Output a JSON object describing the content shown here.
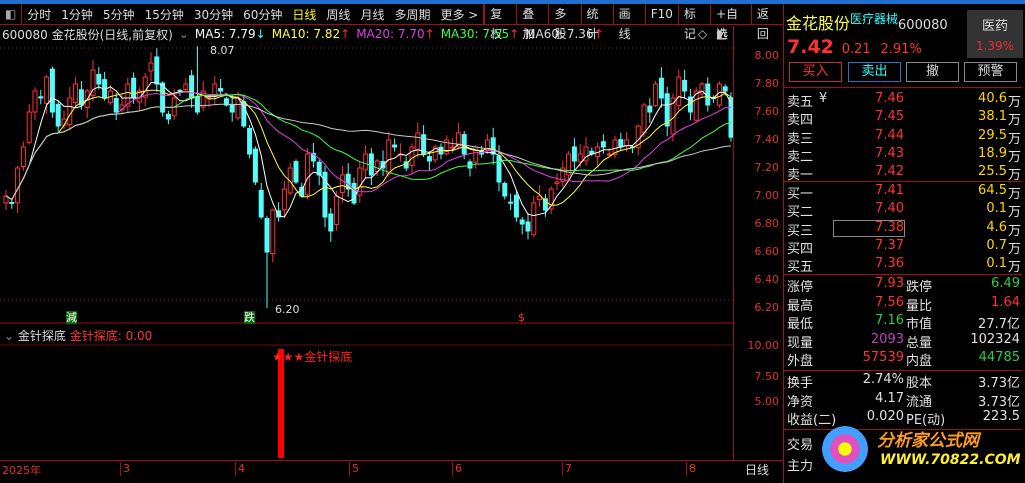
{
  "toolbar": {
    "items": [
      "分时",
      "1分钟",
      "5分钟",
      "15分钟",
      "30分钟",
      "60分钟",
      "日线",
      "周线",
      "月线",
      "多周期",
      "更多 >"
    ],
    "active": "日线",
    "buttons": [
      "复权",
      "叠加",
      "多股",
      "统计",
      "画线",
      "F10",
      "标记",
      "+自选",
      "返回"
    ]
  },
  "info": {
    "title": "600080 金花股份(日线,前复权)",
    "ma5": "MA5: 7.79",
    "ma10": "MA10: 7.82",
    "ma20": "MA20: 7.70",
    "ma30": "MA30: 7.55",
    "ma60": "MA60: 7.36",
    "ma5_dir": "↓",
    "up": "↑"
  },
  "chart_labels": {
    "high": "8.07",
    "low": "6.20",
    "sig1": "減",
    "sig2": "跌",
    "sig3": "$"
  },
  "indicator": {
    "name": "金针探底",
    "value_label": "金针探底: 0.00",
    "signal_text": "★★★金针探底",
    "axis": [
      "10.00",
      "7.50",
      "5.00"
    ]
  },
  "price_axis": [
    "8.00",
    "7.80",
    "7.60",
    "7.40",
    "7.20",
    "7.00",
    "6.80",
    "6.60",
    "6.40",
    "6.20"
  ],
  "time_axis": [
    "2025年",
    "3",
    "4",
    "5",
    "6",
    "7",
    "8"
  ],
  "period_label": "日线",
  "chart_data": {
    "type": "candlestick",
    "ylim": [
      6.1,
      8.2
    ],
    "closes": [
      7.0,
      6.95,
      7.2,
      7.35,
      7.6,
      7.75,
      7.7,
      7.85,
      7.6,
      7.5,
      7.55,
      7.7,
      7.8,
      7.65,
      7.75,
      7.9,
      7.8,
      7.7,
      7.75,
      7.6,
      7.65,
      7.8,
      7.7,
      7.75,
      7.85,
      7.95,
      7.8,
      7.6,
      7.55,
      7.7,
      7.75,
      7.8,
      7.7,
      7.6,
      7.75,
      7.7,
      7.8,
      7.75,
      7.65,
      7.6,
      7.7,
      7.5,
      7.3,
      7.1,
      6.85,
      6.6,
      6.9,
      6.85,
      7.05,
      7.2,
      7.1,
      7.0,
      7.3,
      7.25,
      7.15,
      6.85,
      6.75,
      7.0,
      7.15,
      7.05,
      6.95,
      7.2,
      7.3,
      7.15,
      7.25,
      7.2,
      7.4,
      7.35,
      7.3,
      7.2,
      7.35,
      7.45,
      7.3,
      7.25,
      7.35,
      7.3,
      7.4,
      7.35,
      7.45,
      7.3,
      7.2,
      7.35,
      7.3,
      7.4,
      7.3,
      7.1,
      7.0,
      6.95,
      6.85,
      6.8,
      6.75,
      6.95,
      7.0,
      6.9,
      7.05,
      7.1,
      7.2,
      7.3,
      7.25,
      7.3,
      7.35,
      7.3,
      7.35,
      7.35,
      7.3,
      7.4,
      7.35,
      7.4,
      7.35,
      7.5,
      7.65,
      7.6,
      7.8,
      7.7,
      7.5,
      7.7,
      7.85,
      7.75,
      7.6,
      7.75,
      7.8,
      7.65,
      7.7,
      7.8,
      7.75,
      7.42
    ],
    "extreme_high": {
      "index": 33,
      "value": 8.07
    },
    "extreme_low": {
      "index": 45,
      "value": 6.2
    },
    "ma_periods": [
      5,
      10,
      20,
      30,
      60
    ],
    "indicator_bar": {
      "index": 45,
      "value": 10
    }
  },
  "colors": {
    "up": "#ff3232",
    "down": "#54fcfc",
    "ma5": "#ffffff",
    "ma10": "#ffff40",
    "ma20": "#e040e0",
    "ma30": "#40ff40",
    "ma60": "#c8c8c8"
  },
  "panel": {
    "name": "金花股份",
    "sector": "医疗器械",
    "code": "600080",
    "industry": "医药",
    "industry_pct": "1.39%",
    "price": "7.42",
    "change": "0.21",
    "pct": "2.91%",
    "buttons": [
      "买入",
      "卖出",
      "撤",
      "预警"
    ],
    "asks": [
      {
        "l": "卖五",
        "p": "7.46",
        "v": "40.6",
        "u": "万"
      },
      {
        "l": "卖四",
        "p": "7.45",
        "v": "38.1",
        "u": "万"
      },
      {
        "l": "卖三",
        "p": "7.44",
        "v": "29.5",
        "u": "万"
      },
      {
        "l": "卖二",
        "p": "7.43",
        "v": "18.9",
        "u": "万"
      },
      {
        "l": "卖一",
        "p": "7.42",
        "v": "25.5",
        "u": "万"
      }
    ],
    "yen": "¥",
    "bids": [
      {
        "l": "买一",
        "p": "7.41",
        "v": "64.5",
        "u": "万"
      },
      {
        "l": "买二",
        "p": "7.40",
        "v": "0.1",
        "u": "万"
      },
      {
        "l": "买三",
        "p": "7.38",
        "v": "4.6",
        "u": "万"
      },
      {
        "l": "买四",
        "p": "7.37",
        "v": "0.7",
        "u": "万"
      },
      {
        "l": "买五",
        "p": "7.36",
        "v": "0.1",
        "u": "万"
      }
    ],
    "stats": [
      [
        "涨停",
        "7.93",
        "跌停",
        "6.49"
      ],
      [
        "最高",
        "7.56",
        "量比",
        "1.64"
      ],
      [
        "最低",
        "7.16",
        "市值",
        "27.7亿"
      ],
      [
        "现量",
        "2093",
        "总量",
        "102324"
      ],
      [
        "外盘",
        "57539",
        "内盘",
        "44785"
      ]
    ],
    "stats2": [
      [
        "换手",
        "2.74%",
        "股本",
        "3.73亿"
      ],
      [
        "净资",
        "4.17",
        "流通",
        "3.73亿"
      ],
      [
        "收益(二)",
        "0.020",
        "PE(动)",
        "223.5"
      ]
    ],
    "bottom": [
      "交易",
      "主力"
    ]
  },
  "watermark": {
    "title": "分析家公式网",
    "url": "WWW.70822.COM"
  }
}
